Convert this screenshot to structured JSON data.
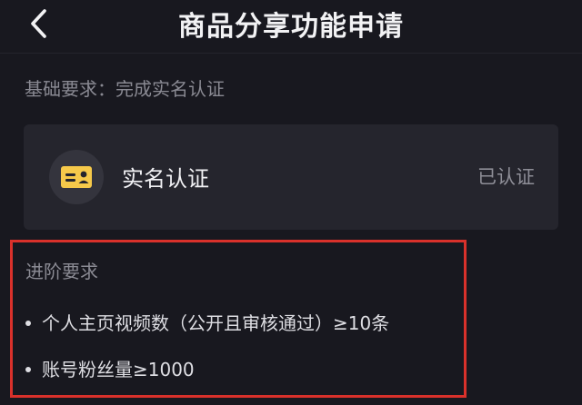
{
  "header": {
    "title": "商品分享功能申请",
    "back_icon": "chevron-left-icon"
  },
  "basic": {
    "text": "基础要求：完成实名认证"
  },
  "verification": {
    "icon": "id-card-icon",
    "label": "实名认证",
    "status": "已认证"
  },
  "advanced": {
    "title": "进阶要求",
    "items": [
      "个人主页视频数（公开且审核通过）≥10条",
      "账号粉丝量≥1000"
    ]
  },
  "colors": {
    "background": "#18181f",
    "card": "#25252d",
    "icon_accent": "#f6c94a",
    "highlight_border": "#d9312b"
  }
}
